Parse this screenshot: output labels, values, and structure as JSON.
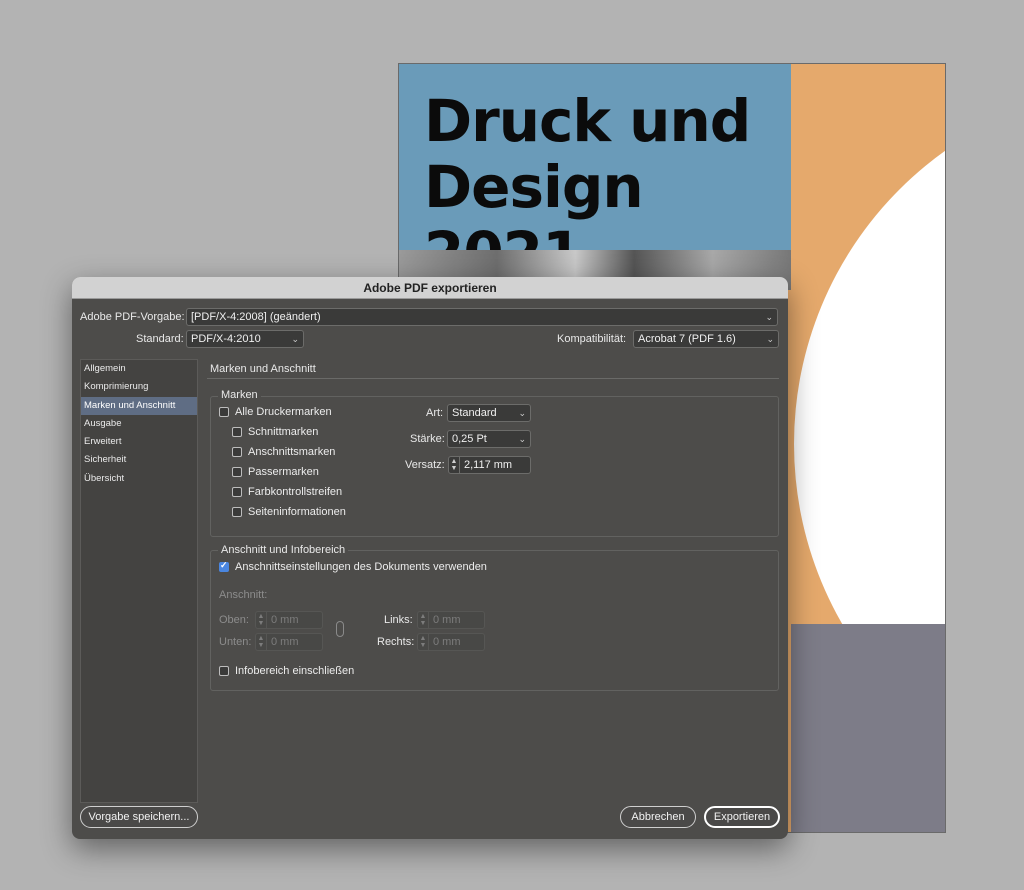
{
  "document": {
    "title_line1": "Druck und",
    "title_line2": "Design 2021"
  },
  "dialog": {
    "title": "Adobe PDF exportieren",
    "preset_label": "Adobe PDF-Vorgabe:",
    "preset_value": "[PDF/X-4:2008] (geändert)",
    "standard_label": "Standard:",
    "standard_value": "PDF/X-4:2010",
    "compat_label": "Kompatibilität:",
    "compat_value": "Acrobat 7 (PDF 1.6)",
    "sidebar": [
      {
        "label": "Allgemein",
        "selected": false
      },
      {
        "label": "Komprimierung",
        "selected": false
      },
      {
        "label": "Marken und Anschnitt",
        "selected": true
      },
      {
        "label": "Ausgabe",
        "selected": false
      },
      {
        "label": "Erweitert",
        "selected": false
      },
      {
        "label": "Sicherheit",
        "selected": false
      },
      {
        "label": "Übersicht",
        "selected": false
      }
    ],
    "section_title": "Marken und Anschnitt",
    "marks": {
      "group_title": "Marken",
      "all_marks": "Alle Druckermarken",
      "crop": "Schnittmarken",
      "bleed": "Anschnittsmarken",
      "registration": "Passermarken",
      "color_bars": "Farbkontrollstreifen",
      "page_info": "Seiteninformationen",
      "type_label": "Art:",
      "type_value": "Standard",
      "weight_label": "Stärke:",
      "weight_value": "0,25 Pt",
      "offset_label": "Versatz:",
      "offset_value": "2,117 mm"
    },
    "bleed": {
      "group_title": "Anschnitt und Infobereich",
      "use_doc": "Anschnittseinstellungen des Dokuments verwenden",
      "use_doc_checked": true,
      "bleed_label": "Anschnitt:",
      "top_label": "Oben:",
      "top_value": "0 mm",
      "bottom_label": "Unten:",
      "bottom_value": "0 mm",
      "left_label": "Links:",
      "left_value": "0 mm",
      "right_label": "Rechts:",
      "right_value": "0 mm",
      "slug": "Infobereich einschließen"
    },
    "buttons": {
      "save_preset": "Vorgabe speichern...",
      "cancel": "Abbrechen",
      "export": "Exportieren"
    }
  }
}
